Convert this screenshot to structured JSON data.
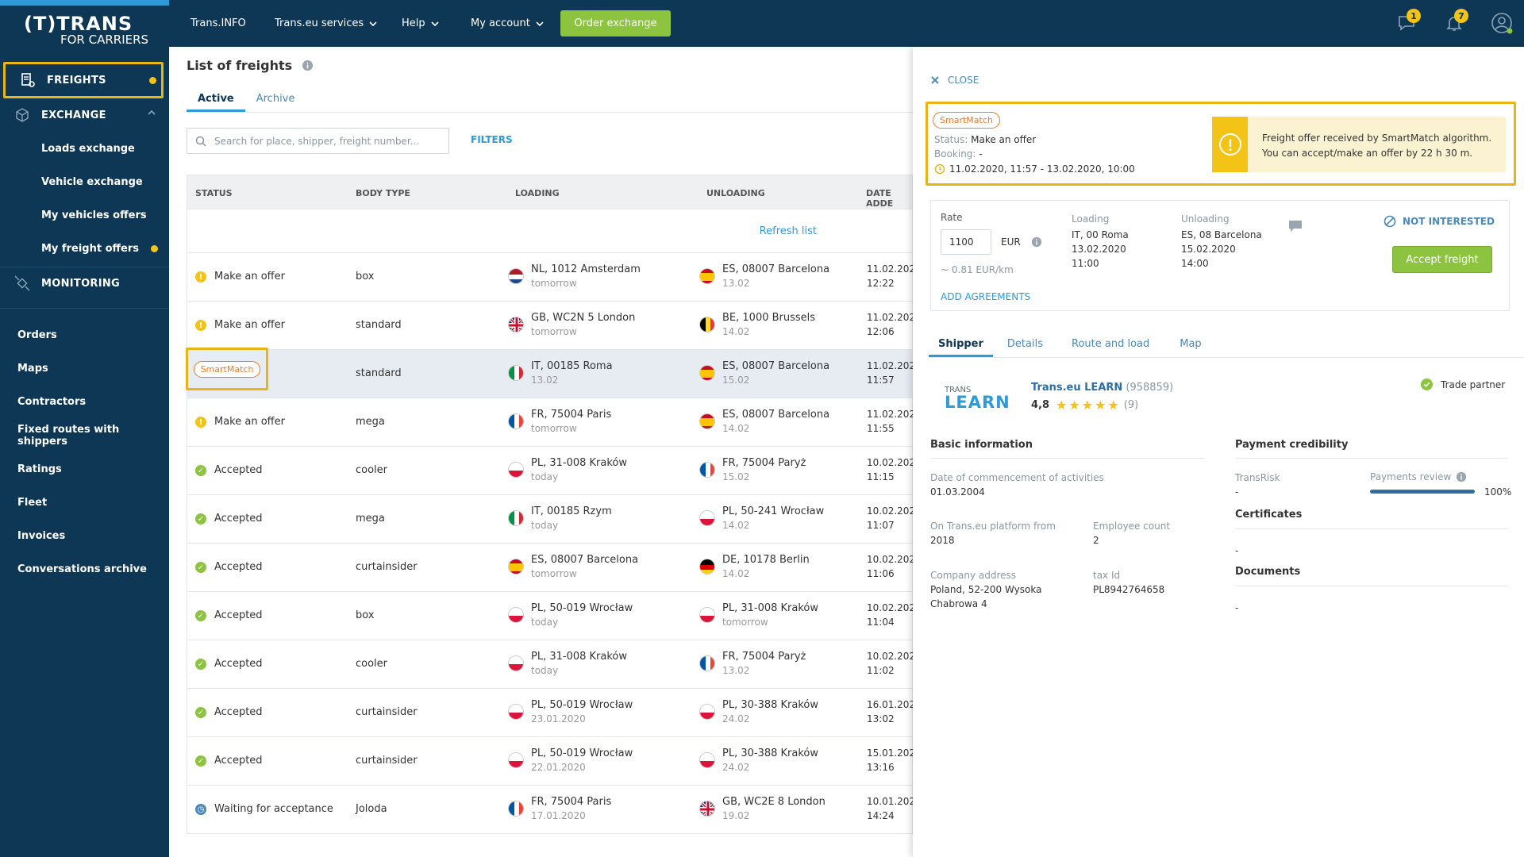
{
  "brand": {
    "line1": "(T)TRANS",
    "line2": "FOR CARRIERS"
  },
  "sidebar": {
    "freights": "FREIGHTS",
    "exchange": "EXCHANGE",
    "loads_exchange": "Loads exchange",
    "vehicle_exchange": "Vehicle exchange",
    "my_vehicles_offers": "My vehicles offers",
    "my_freight_offers": "My freight offers",
    "monitoring": "MONITORING",
    "orders": "Orders",
    "maps": "Maps",
    "contractors": "Contractors",
    "fixed_routes": "Fixed routes with shippers",
    "ratings": "Ratings",
    "fleet": "Fleet",
    "invoices": "Invoices",
    "conversations_archive": "Conversations archive"
  },
  "topnav": {
    "trans_info": "Trans.INFO",
    "services": "Trans.eu services",
    "help": "Help",
    "my_account": "My account",
    "order_exchange": "Order exchange",
    "messages_badge": "1",
    "notifications_badge": "7"
  },
  "list": {
    "title": "List of freights",
    "tab_active": "Active",
    "tab_archive": "Archive",
    "search_placeholder": "Search for place, shipper, freight number...",
    "filters": "FILTERS",
    "refresh": "Refresh list",
    "headers": {
      "status": "STATUS",
      "body_type": "BODY TYPE",
      "loading": "LOADING",
      "unloading": "UNLOADING",
      "date_added": "DATE ADDE"
    },
    "rows": [
      {
        "status": "Make an offer",
        "kind": "offer",
        "body": "box",
        "l_flag": "nl",
        "l_place": "NL, 1012 Amsterdam",
        "l_when": "tomorrow",
        "u_flag": "es",
        "u_place": "ES, 08007 Barcelona",
        "u_when": "13.02",
        "date": "11.02.202",
        "time": "12:22"
      },
      {
        "status": "Make an offer",
        "kind": "offer",
        "body": "standard",
        "l_flag": "gb",
        "l_place": "GB, WC2N 5 London",
        "l_when": "tomorrow",
        "u_flag": "be",
        "u_place": "BE, 1000 Brussels",
        "u_when": "14.02",
        "date": "11.02.202",
        "time": "12:06"
      },
      {
        "status": "SmartMatch",
        "kind": "smart",
        "body": "standard",
        "l_flag": "it",
        "l_place": "IT, 00185 Roma",
        "l_when": "13.02",
        "u_flag": "es",
        "u_place": "ES, 08007 Barcelona",
        "u_when": "15.02",
        "date": "11.02.202",
        "time": "11:57"
      },
      {
        "status": "Make an offer",
        "kind": "offer",
        "body": "mega",
        "l_flag": "fr",
        "l_place": "FR, 75004 Paris",
        "l_when": "tomorrow",
        "u_flag": "es",
        "u_place": "ES, 08007 Barcelona",
        "u_when": "14.02",
        "date": "11.02.202",
        "time": "11:55"
      },
      {
        "status": "Accepted",
        "kind": "ok",
        "body": "cooler",
        "l_flag": "pl",
        "l_place": "PL, 31-008 Kraków",
        "l_when": "today",
        "u_flag": "fr",
        "u_place": "FR, 75004 Paryż",
        "u_when": "15.02",
        "date": "10.02.202",
        "time": "11:15"
      },
      {
        "status": "Accepted",
        "kind": "ok",
        "body": "mega",
        "l_flag": "it",
        "l_place": "IT, 00185 Rzym",
        "l_when": "today",
        "u_flag": "pl",
        "u_place": "PL, 50-241 Wrocław",
        "u_when": "14.02",
        "date": "10.02.202",
        "time": "11:07"
      },
      {
        "status": "Accepted",
        "kind": "ok",
        "body": "curtainsider",
        "l_flag": "es",
        "l_place": "ES, 08007 Barcelona",
        "l_when": "tomorrow",
        "u_flag": "de",
        "u_place": "DE, 10178 Berlin",
        "u_when": "14.02",
        "date": "10.02.202",
        "time": "11:06"
      },
      {
        "status": "Accepted",
        "kind": "ok",
        "body": "box",
        "l_flag": "pl",
        "l_place": "PL, 50-019 Wrocław",
        "l_when": "today",
        "u_flag": "pl",
        "u_place": "PL, 31-008 Kraków",
        "u_when": "tomorrow",
        "date": "10.02.202",
        "time": "11:04"
      },
      {
        "status": "Accepted",
        "kind": "ok",
        "body": "cooler",
        "l_flag": "pl",
        "l_place": "PL, 31-008 Kraków",
        "l_when": "today",
        "u_flag": "fr",
        "u_place": "FR, 75004 Paryż",
        "u_when": "13.02",
        "date": "10.02.202",
        "time": "11:02"
      },
      {
        "status": "Accepted",
        "kind": "ok",
        "body": "curtainsider",
        "l_flag": "pl",
        "l_place": "PL, 50-019 Wrocław",
        "l_when": "23.01.2020",
        "u_flag": "pl",
        "u_place": "PL, 30-388 Kraków",
        "u_when": "24.02",
        "date": "16.01.202",
        "time": "13:02"
      },
      {
        "status": "Accepted",
        "kind": "ok",
        "body": "curtainsider",
        "l_flag": "pl",
        "l_place": "PL, 50-019 Wrocław",
        "l_when": "22.01.2020",
        "u_flag": "pl",
        "u_place": "PL, 30-388 Kraków",
        "u_when": "24.02",
        "date": "15.01.202",
        "time": "13:16"
      },
      {
        "status": "Waiting for acceptance",
        "kind": "wait",
        "body": "Joloda",
        "l_flag": "fr",
        "l_place": "FR, 75004 Paris",
        "l_when": "17.01.2020",
        "u_flag": "gb",
        "u_place": "GB, WC2E 8 London",
        "u_when": "19.02",
        "date": "10.01.202",
        "time": "14:24"
      }
    ]
  },
  "panel": {
    "close": "CLOSE",
    "smartmatch": "SmartMatch",
    "status_label": "Status:",
    "status_value": "Make an offer",
    "booking_label": "Booking:",
    "booking_value": "-",
    "period": "11.02.2020, 11:57 - 13.02.2020, 10:00",
    "alert_line1": "Freight offer received by SmartMatch algorithm.",
    "alert_line2": "You can accept/make an offer by 22 h 30 m.",
    "rate_label": "Rate",
    "rate_value": "1100",
    "currency": "EUR",
    "per_km": "~ 0.81 EUR/km",
    "loading_label": "Loading",
    "loading_place": "IT, 00 Roma",
    "loading_date": "13.02.2020",
    "loading_time": "11:00",
    "unloading_label": "Unloading",
    "unloading_place": "ES, 08 Barcelona",
    "unloading_date": "15.02.2020",
    "unloading_time": "14:00",
    "not_interested": "NOT INTERESTED",
    "accept": "Accept freight",
    "add_agreements": "ADD AGREEMENTS",
    "tabs": [
      "Shipper",
      "Details",
      "Route and load",
      "Map"
    ],
    "company_logo_top": "TRANS",
    "company_logo_bottom": "LEARN",
    "company_name": "Trans.eu LEARN",
    "company_id": "(958859)",
    "rating": "4,8",
    "rating_count": "(9)",
    "trade_partner": "Trade partner",
    "basic_info": "Basic information",
    "commence_label": "Date of commencement of activities",
    "commence_value": "01.03.2004",
    "platform_label": "On Trans.eu platform from",
    "platform_value": "2018",
    "employee_label": "Employee count",
    "employee_value": "2",
    "address_label": "Company address",
    "address_line1": "Poland, 52-200 Wysoka",
    "address_line2": "Chabrowa 4",
    "tax_label": "tax Id",
    "tax_value": "PL8942764658",
    "payment_cred": "Payment credibility",
    "transrisk_label": "TransRisk",
    "transrisk_value": "-",
    "payments_review_label": "Payments review",
    "payments_review_value": "100%",
    "payments_review_fraction": 1.0,
    "certificates": "Certificates",
    "certificates_value": "-",
    "documents": "Documents",
    "documents_value": "-"
  },
  "colors": {
    "navy": "#0d3755",
    "green": "#8cc43f",
    "yellow": "#f3c315",
    "orange": "#ef7a28",
    "blue": "#2f9ad6"
  }
}
